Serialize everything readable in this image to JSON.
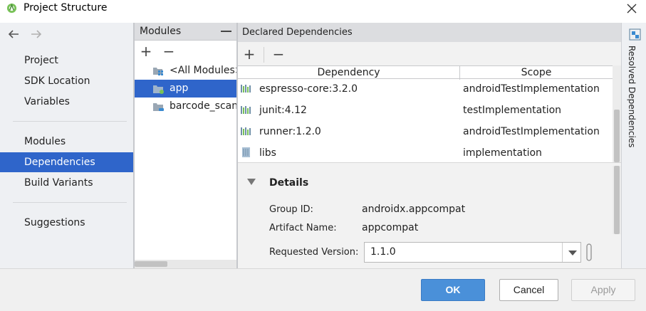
{
  "window": {
    "title": "Project Structure"
  },
  "nav": {
    "items_top": [
      {
        "label": "Project"
      },
      {
        "label": "SDK Location"
      },
      {
        "label": "Variables"
      }
    ],
    "items_mid": [
      {
        "label": "Modules"
      },
      {
        "label": "Dependencies",
        "selected": true
      },
      {
        "label": "Build Variants"
      }
    ],
    "items_bottom": [
      {
        "label": "Suggestions"
      }
    ]
  },
  "modules": {
    "header": "Modules",
    "items": [
      {
        "label": "<All Modules>"
      },
      {
        "label": "app",
        "selected": true
      },
      {
        "label": "barcode_scanner"
      }
    ]
  },
  "deps": {
    "header": "Declared Dependencies",
    "columns": [
      "Dependency",
      "Scope"
    ],
    "rows": [
      {
        "name": "espresso-core:3.2.0",
        "scope": "androidTestImplementation",
        "icon": "library-icon"
      },
      {
        "name": "junit:4.12",
        "scope": "testImplementation",
        "icon": "library-icon"
      },
      {
        "name": "runner:1.2.0",
        "scope": "androidTestImplementation",
        "icon": "library-icon"
      },
      {
        "name": "libs",
        "scope": "implementation",
        "icon": "jar-dir-icon"
      }
    ]
  },
  "details": {
    "title": "Details",
    "group_label": "Group ID:",
    "group_value": "androidx.appcompat",
    "artifact_label": "Artifact Name:",
    "artifact_value": "appcompat",
    "version_label": "Requested Version:",
    "version_value": "1.1.0"
  },
  "side_tab": {
    "label": "Resolved Dependencies"
  },
  "footer": {
    "ok": "OK",
    "cancel": "Cancel",
    "apply": "Apply"
  },
  "colors": {
    "selection": "#2f65ca",
    "ok_button": "#4a90d9",
    "android_green": "#78c257"
  }
}
